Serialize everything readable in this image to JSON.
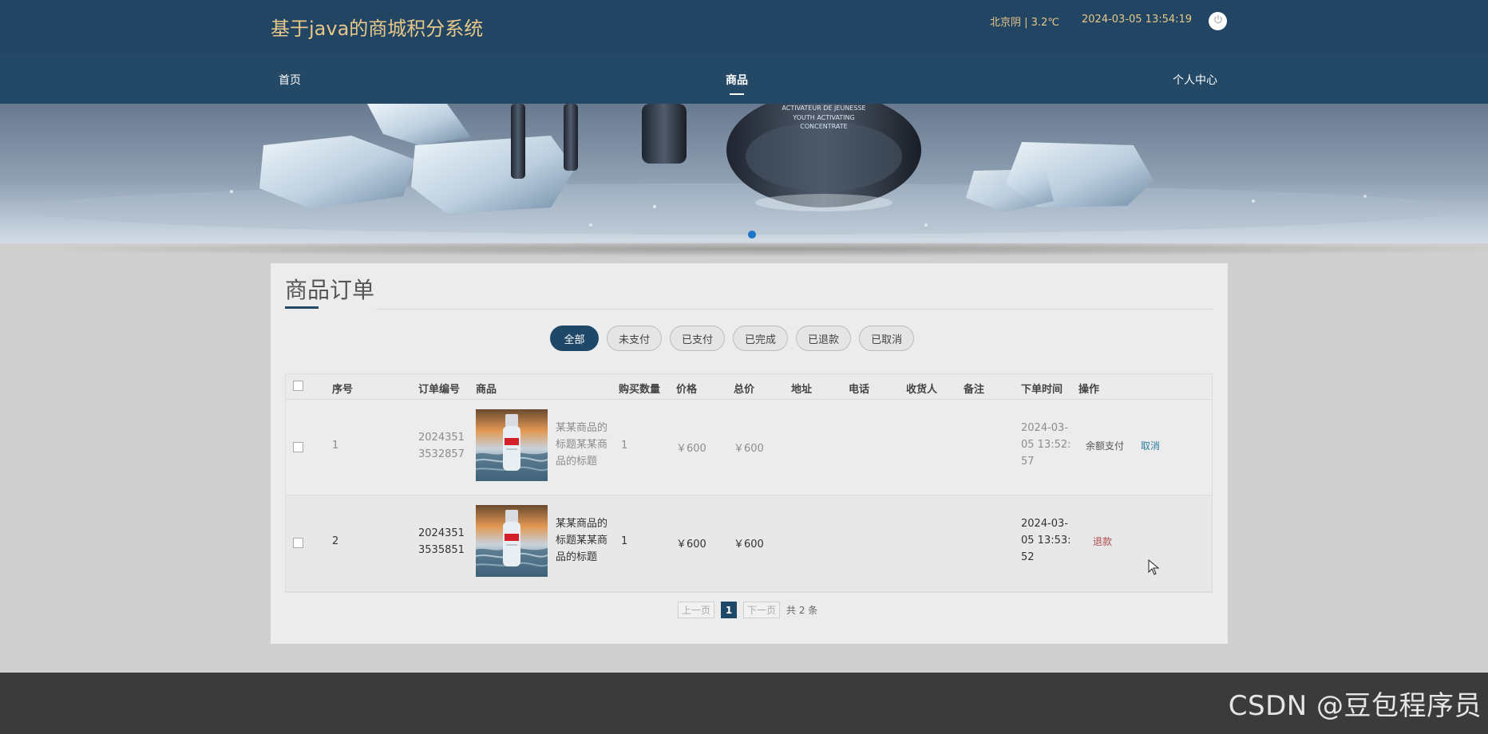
{
  "header": {
    "site_title": "基于java的商城积分系统",
    "weather": "北京阴 | 3.2℃",
    "datetime": "2024-03-05   13:54:19",
    "power_icon": "power-icon"
  },
  "nav": {
    "items": [
      {
        "label": "首页"
      },
      {
        "label": "商品"
      },
      {
        "label": "个人中心"
      }
    ],
    "active": "商品"
  },
  "banner": {
    "text_lines": [
      "ACTIVATEUR DE JEUNESSE",
      "YOUTH ACTIVATING",
      "CONCENTRATE"
    ]
  },
  "content": {
    "title": "商品订单",
    "tabs": [
      {
        "label": "全部",
        "active": true
      },
      {
        "label": "未支付",
        "active": false
      },
      {
        "label": "已支付",
        "active": false
      },
      {
        "label": "已完成",
        "active": false
      },
      {
        "label": "已退款",
        "active": false
      },
      {
        "label": "已取消",
        "active": false
      }
    ],
    "table": {
      "headers": [
        "序号",
        "订单编号",
        "商品",
        "购买数量",
        "价格",
        "总价",
        "地址",
        "电话",
        "收货人",
        "备注",
        "下单时间",
        "操作"
      ],
      "rows": [
        {
          "index": "1",
          "order_no_line1": "2024351",
          "order_no_line2": "3532857",
          "product_name_line1": "某某商品的",
          "product_name_line2": "标题某某商",
          "product_name_line3": "品的标题",
          "quantity": "1",
          "price": "￥600",
          "total": "￥600",
          "address": "",
          "phone": "",
          "receiver": "",
          "note": "",
          "time_line1": "2024-03-",
          "time_line2": "05 13:52:",
          "time_line3": "57",
          "action1": "余额支付",
          "action2": "取消"
        },
        {
          "index": "2",
          "order_no_line1": "2024351",
          "order_no_line2": "3535851",
          "product_name_line1": "某某商品的",
          "product_name_line2": "标题某某商",
          "product_name_line3": "品的标题",
          "quantity": "1",
          "price": "￥600",
          "total": "￥600",
          "address": "",
          "phone": "",
          "receiver": "",
          "note": "",
          "time_line1": "2024-03-",
          "time_line2": "05 13:53:",
          "time_line3": "52",
          "action1": "退款"
        }
      ]
    },
    "pagination": {
      "prev": "上一页",
      "current": "1",
      "next": "下一页",
      "total": "共 2 条"
    }
  },
  "footer": {
    "watermark": "CSDN @豆包程序员"
  },
  "colors": {
    "header_bg": "#244966",
    "accent": "#1f4868",
    "title_gold": "#e8c88a",
    "footer_bg": "#3b3b3b",
    "page_bg": "#cfcfcf"
  }
}
